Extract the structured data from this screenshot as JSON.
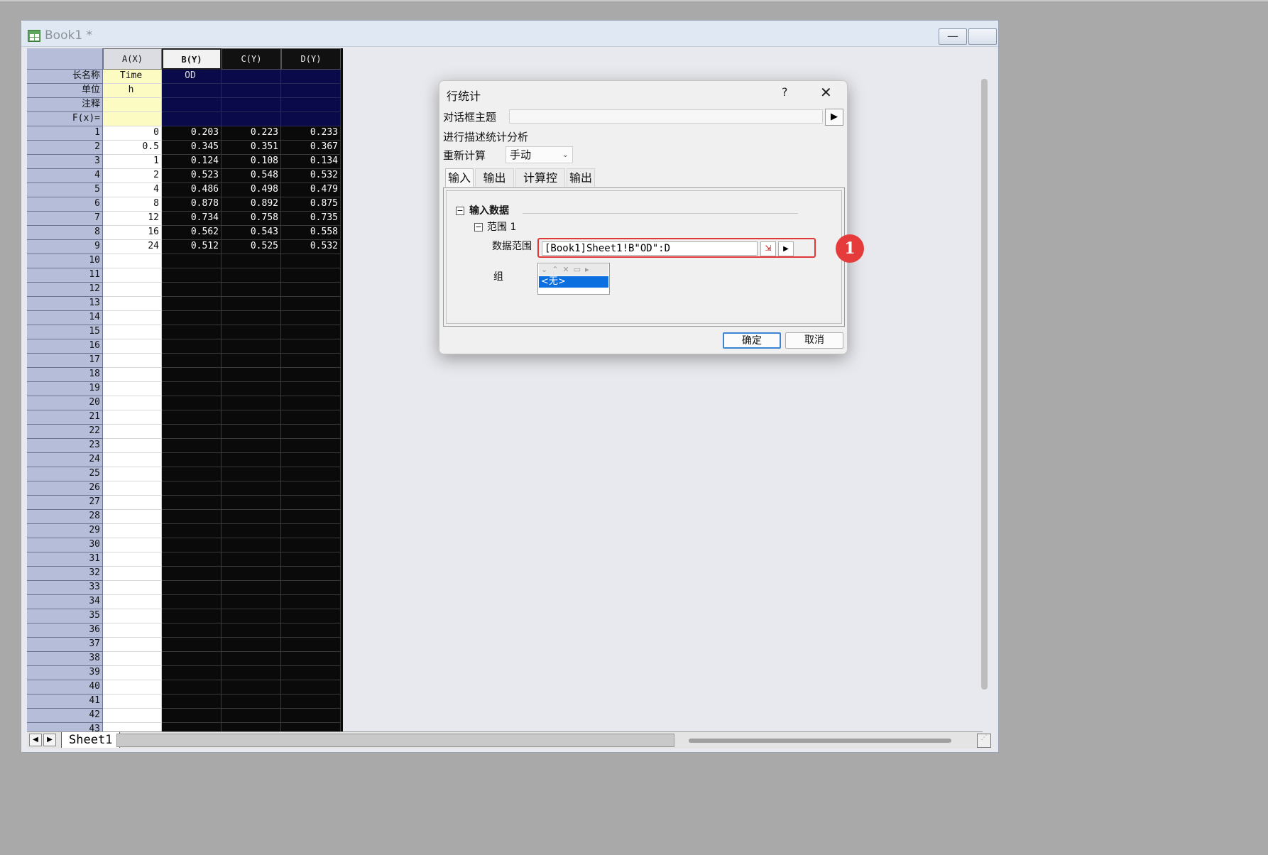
{
  "window": {
    "title": "Book1 *",
    "buttons": [
      "—",
      "▢",
      "✕"
    ]
  },
  "worksheet": {
    "columns": [
      "A(X)",
      "B(Y)",
      "C(Y)",
      "D(Y)"
    ],
    "header_rows": [
      "长名称",
      "单位",
      "注释",
      "F(x)="
    ],
    "long_names": [
      "Time",
      "OD",
      "",
      ""
    ],
    "units": [
      "h",
      "",
      "",
      ""
    ],
    "row_count_visible": 43,
    "rows": [
      [
        "0",
        "0.203",
        "0.223",
        "0.233"
      ],
      [
        "0.5",
        "0.345",
        "0.351",
        "0.367"
      ],
      [
        "1",
        "0.124",
        "0.108",
        "0.134"
      ],
      [
        "2",
        "0.523",
        "0.548",
        "0.532"
      ],
      [
        "4",
        "0.486",
        "0.498",
        "0.479"
      ],
      [
        "8",
        "0.878",
        "0.892",
        "0.875"
      ],
      [
        "12",
        "0.734",
        "0.758",
        "0.735"
      ],
      [
        "16",
        "0.562",
        "0.543",
        "0.558"
      ],
      [
        "24",
        "0.512",
        "0.525",
        "0.532"
      ]
    ],
    "sheet_tab": "Sheet1",
    "nav_left": "◀",
    "nav_right": "▶"
  },
  "dialog": {
    "title": "行统计",
    "help": "?",
    "close": "✕",
    "theme_label": "对话框主题",
    "theme_button": "▶",
    "description": "进行描述统计分析",
    "recalc_label": "重新计算",
    "recalc_value": "手动",
    "tabs": [
      "输入",
      "输出量",
      "计算控制",
      "输出"
    ],
    "section_input": "输入数据",
    "range_node": "范围 1",
    "data_range_label": "数据范围",
    "data_range_value": "[Book1]Sheet1!B\"OD\":D",
    "group_label": "组",
    "group_value": "<无>",
    "ok": "确定",
    "cancel": "取消",
    "tree_toggle": "⊟"
  },
  "annotation": {
    "badge": "1",
    "color": "#e53b3b"
  }
}
